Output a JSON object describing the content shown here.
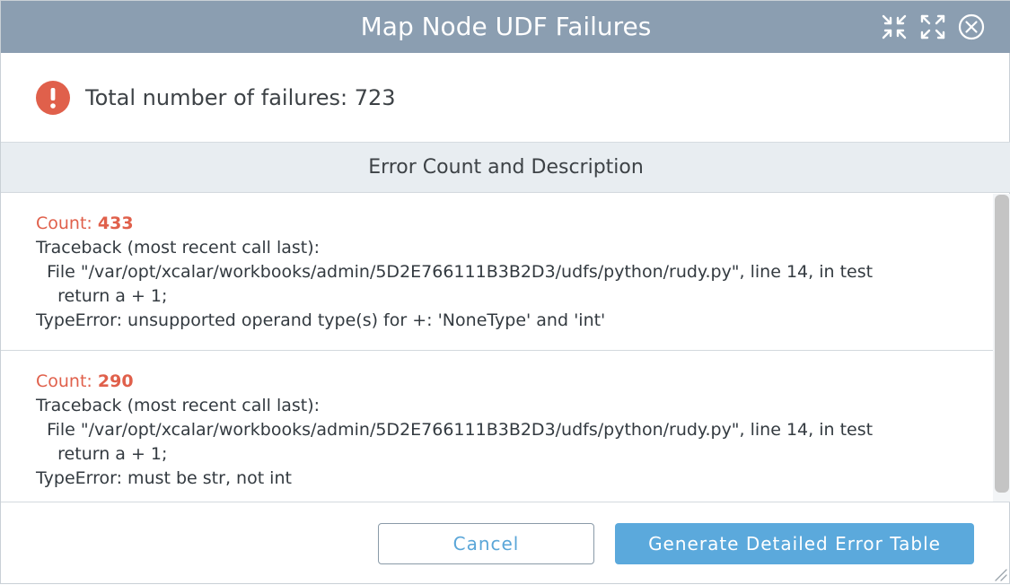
{
  "window": {
    "title": "Map Node UDF Failures",
    "icons": [
      "minimize-icon",
      "maximize-icon",
      "close-icon"
    ]
  },
  "summary": {
    "icon": "exclamation-icon",
    "total_label": "Total number of failures: 723"
  },
  "section": {
    "title": "Error Count and Description"
  },
  "errors": [
    {
      "count_prefix": "Count: ",
      "count": "433",
      "description": "Traceback (most recent call last):\n  File \"/var/opt/xcalar/workbooks/admin/5D2E766111B3B2D3/udfs/python/rudy.py\", line 14, in test\n    return a + 1;\nTypeError: unsupported operand type(s) for +: 'NoneType' and 'int'"
    },
    {
      "count_prefix": "Count: ",
      "count": "290",
      "description": "Traceback (most recent call last):\n  File \"/var/opt/xcalar/workbooks/admin/5D2E766111B3B2D3/udfs/python/rudy.py\", line 14, in test\n    return a + 1;\nTypeError: must be str, not int"
    }
  ],
  "footer": {
    "cancel_label": "Cancel",
    "generate_label": "Generate Detailed Error Table"
  },
  "colors": {
    "header_bg": "#8b9eb1",
    "accent_red": "#e0604b",
    "primary_blue": "#5ba9dc",
    "section_bg": "#e8edf1"
  }
}
